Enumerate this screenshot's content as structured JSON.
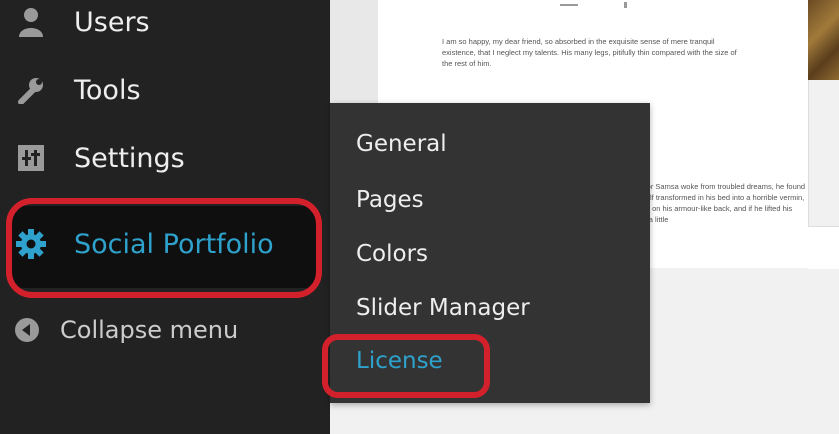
{
  "sidebar": {
    "items": [
      {
        "label": "Users",
        "icon": "users-icon"
      },
      {
        "label": "Tools",
        "icon": "wrench-icon"
      },
      {
        "label": "Settings",
        "icon": "settings-sliders-icon"
      },
      {
        "label": "Social Portfolio",
        "icon": "gear-icon"
      },
      {
        "label": "Collapse menu",
        "icon": "collapse-arrow-icon"
      }
    ]
  },
  "submenu": {
    "items": [
      {
        "label": "General"
      },
      {
        "label": "Pages"
      },
      {
        "label": "Colors"
      },
      {
        "label": "Slider Manager"
      },
      {
        "label": "License"
      }
    ]
  },
  "preview": {
    "paragraph_1": "I am so happy, my dear friend, so absorbed in the exquisite sense of mere tranquil existence, that I neglect my talents. His many legs, pitifully thin compared with the size of the rest of him.",
    "paragraph_2": "Gregor Samsa woke from troubled dreams, he found himself transformed in his bed into a horrible vermin, he lay on his armour-like back, and if he lifted his head a little"
  },
  "colors": {
    "sidebar_bg": "#222222",
    "flyout_bg": "#333333",
    "accent_blue": "#2ea2cc",
    "annotation_red": "#d3212b"
  }
}
